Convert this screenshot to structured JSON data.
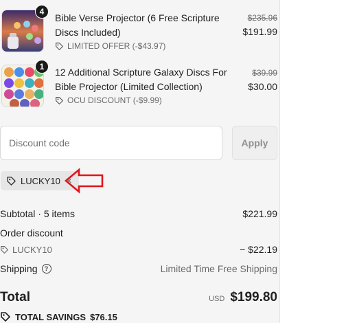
{
  "items": [
    {
      "quantity": "4",
      "title": "Bible Verse Projector (6 Free Scripture Discs Included)",
      "tag_icon": "tag-icon",
      "tag_text": "LIMITED OFFER (-$43.97)",
      "original_price": "$235.96",
      "price": "$191.99"
    },
    {
      "quantity": "1",
      "title": "12 Additional Scripture Galaxy Discs For Bible Projector (Limited Collection)",
      "tag_icon": "tag-icon",
      "tag_text": "OCU DISCOUNT (-$9.99)",
      "original_price": "$39.99",
      "price": "$30.00"
    }
  ],
  "discount": {
    "placeholder": "Discount code",
    "apply_label": "Apply"
  },
  "applied_code": {
    "code": "LUCKY10",
    "remove_icon": "close-icon"
  },
  "summary": {
    "subtotal_label": "Subtotal · 5 items",
    "subtotal_value": "$221.99",
    "order_discount_label": "Order discount",
    "discount_code": "LUCKY10",
    "discount_value": "− $22.19",
    "shipping_label": "Shipping",
    "shipping_value": "Limited Time Free Shipping",
    "total_label": "Total",
    "currency": "USD",
    "total_value": "$199.80",
    "savings_label": "TOTAL SAVINGS",
    "savings_value": "$76.15"
  },
  "colors": {
    "panel_bg": "#f5f5f5",
    "annotation_arrow": "#e0151b"
  }
}
